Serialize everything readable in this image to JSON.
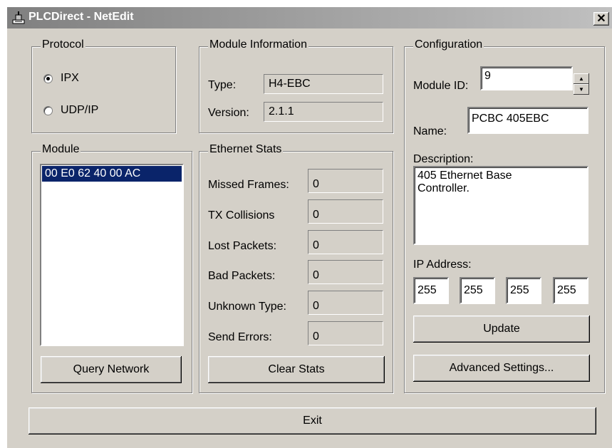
{
  "title": "PLCDirect - NetEdit",
  "close_label": "✕",
  "protocol": {
    "legend": "Protocol",
    "options": [
      "IPX",
      "UDP/IP"
    ],
    "selected": "IPX"
  },
  "module_info": {
    "legend": "Module Information",
    "type_label": "Type:",
    "type_value": "H4-EBC",
    "version_label": "Version:",
    "version_value": "2.1.1"
  },
  "configuration": {
    "legend": "Configuration",
    "module_id_label": "Module ID:",
    "module_id_value": "9",
    "name_label": "Name:",
    "name_value": "PCBC 405EBC",
    "description_label": "Description:",
    "description_value": "405 Ethernet Base Controller.",
    "ip_label": "IP Address:",
    "ip": [
      "255",
      "255",
      "255",
      "255"
    ],
    "update_button": "Update",
    "advanced_button": "Advanced Settings..."
  },
  "module": {
    "legend": "Module",
    "items": [
      "00 E0 62 40 00 AC"
    ],
    "query_button": "Query Network"
  },
  "ethernet_stats": {
    "legend": "Ethernet Stats",
    "rows": [
      {
        "label": "Missed Frames:",
        "value": "0"
      },
      {
        "label": "TX Collisions",
        "value": "0"
      },
      {
        "label": "Lost Packets:",
        "value": "0"
      },
      {
        "label": "Bad Packets:",
        "value": "0"
      },
      {
        "label": "Unknown Type:",
        "value": "0"
      },
      {
        "label": "Send Errors:",
        "value": "0"
      }
    ],
    "clear_button": "Clear Stats"
  },
  "exit_button": "Exit"
}
